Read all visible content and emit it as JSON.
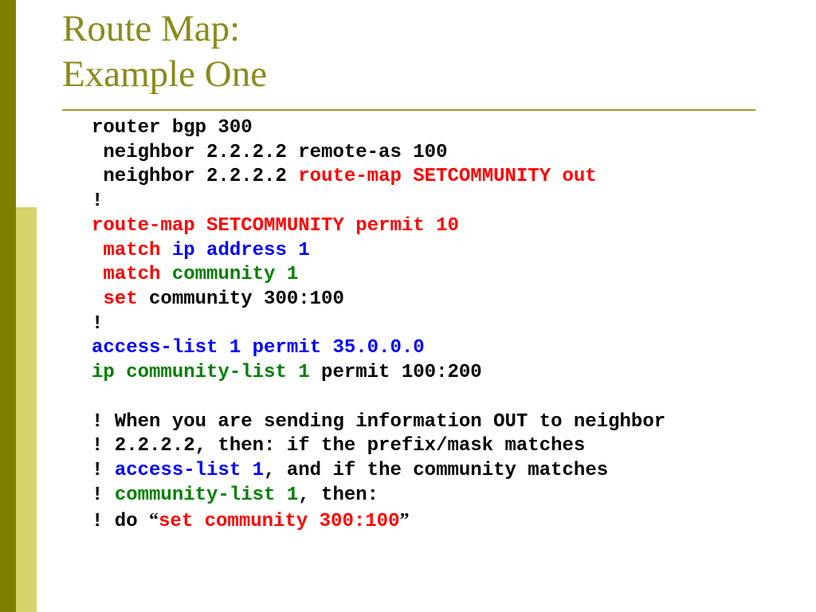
{
  "title": {
    "line1": "Route Map:",
    "line2": "Example One"
  },
  "code": {
    "l1": "router bgp 300",
    "l2": " neighbor 2.2.2.2 remote-as 100",
    "l3a": " neighbor 2.2.2.2 ",
    "l3b": "route-map SETCOMMUNITY out",
    "l4": "!",
    "l5": "route-map SETCOMMUNITY permit 10",
    "l6a": " match ",
    "l6b": "ip address 1",
    "l7a": " match ",
    "l7b": "community 1",
    "l8a": " set ",
    "l8b": "community 300:100",
    "l9": "!",
    "l10": "access-list 1 permit 35.0.0.0",
    "l11a": "ip community-list 1 ",
    "l11b": "permit 100:200",
    "l13": "! When you are sending information OUT to neighbor",
    "l14": "! 2.2.2.2, then: if the prefix/mask matches",
    "l15a": "! ",
    "l15b": "access-list 1",
    "l15c": ", and if the community matches",
    "l16a": "! ",
    "l16b": "community-list 1",
    "l16c": ", then:",
    "l17a": "! do ",
    "l17b": "set community 300:100"
  }
}
